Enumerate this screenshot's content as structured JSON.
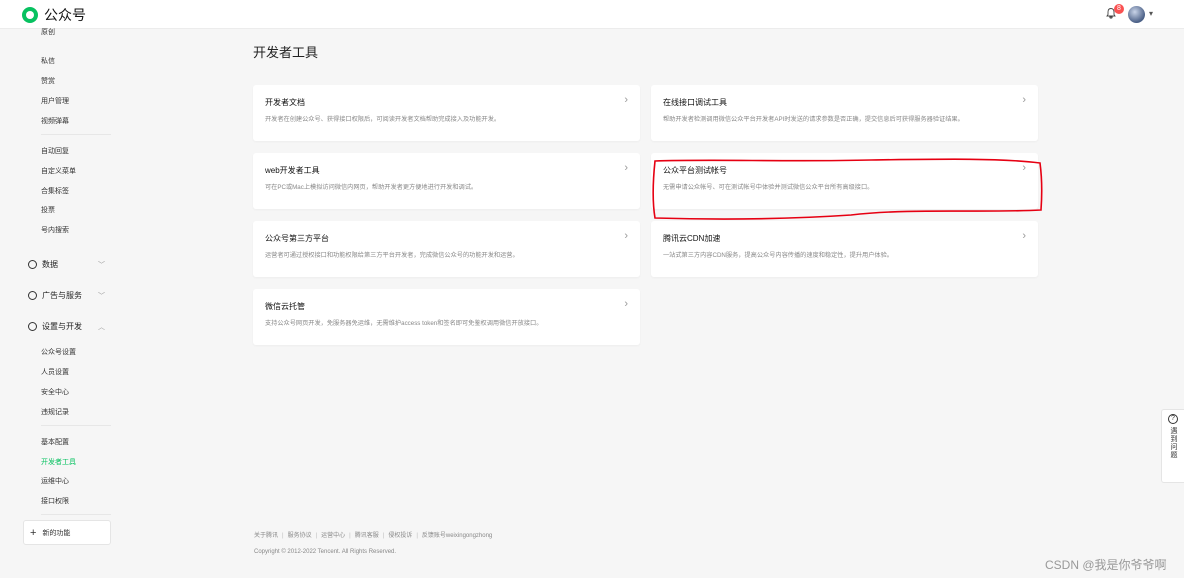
{
  "topbar": {
    "app_name": "公众号",
    "notification_count": "8"
  },
  "sidebar": {
    "items_top": [
      "原创",
      "私信",
      "赞赏",
      "用户管理",
      "视频弹幕"
    ],
    "items_func": [
      "自动回复",
      "自定义菜单",
      "合集标签",
      "投票",
      "号内搜索"
    ],
    "groups": [
      {
        "label": "数据",
        "icon": "clock-icon"
      },
      {
        "label": "广告与服务",
        "icon": "compass-icon"
      },
      {
        "label": "设置与开发",
        "icon": "gear-icon"
      }
    ],
    "items_settings": [
      "公众号设置",
      "人员设置",
      "安全中心",
      "违规记录"
    ],
    "items_dev": [
      "基本配置",
      "开发者工具",
      "运维中心",
      "接口权限"
    ],
    "active_item": "开发者工具",
    "new_func": "新的功能"
  },
  "main": {
    "title": "开发者工具",
    "cards": [
      {
        "title": "开发者文档",
        "desc": "开发者在创建公众号、获得接口权限后，可阅读开发者文档帮助完成接入及功能开发。"
      },
      {
        "title": "在线接口调试工具",
        "desc": "帮助开发者检测调用微信公众平台开发者API时发送的请求参数是否正确，提交信息后可获得服务器验证结果。"
      },
      {
        "title": "web开发者工具",
        "desc": "可在PC或Mac上模拟访问微信内网页，帮助开发者更方便地进行开发和调试。"
      },
      {
        "title": "公众平台测试帐号",
        "desc": "无需申请公众帐号、可在测试帐号中体验并测试微信公众平台所有高级接口。"
      },
      {
        "title": "公众号第三方平台",
        "desc": "运营者可通过授权接口和功能权限给第三方平台开发者，完成微信公众号的功能开发和运营。"
      },
      {
        "title": "腾讯云CDN加速",
        "desc": "一站式第三方内容CDN服务，提高公众号内容传播的速度和稳定性，提升用户体验。"
      },
      {
        "title": "微信云托管",
        "desc": "支持公众号网页开发，免服务器免运维，无需维护access token和签名即可免鉴权调用微信开放接口。"
      }
    ]
  },
  "footer": {
    "links": [
      "关于腾讯",
      "服务协议",
      "运营中心",
      "腾讯客服",
      "侵权投诉",
      "反馈账号weixingongzhong"
    ],
    "copyright": "Copyright © 2012-2022 Tencent. All Rights Reserved."
  },
  "feedback": {
    "label": "遇到问题"
  },
  "watermark": "CSDN @我是你爷爷啊",
  "colors": {
    "accent": "#07c160",
    "highlight_stroke": "#e60012"
  }
}
